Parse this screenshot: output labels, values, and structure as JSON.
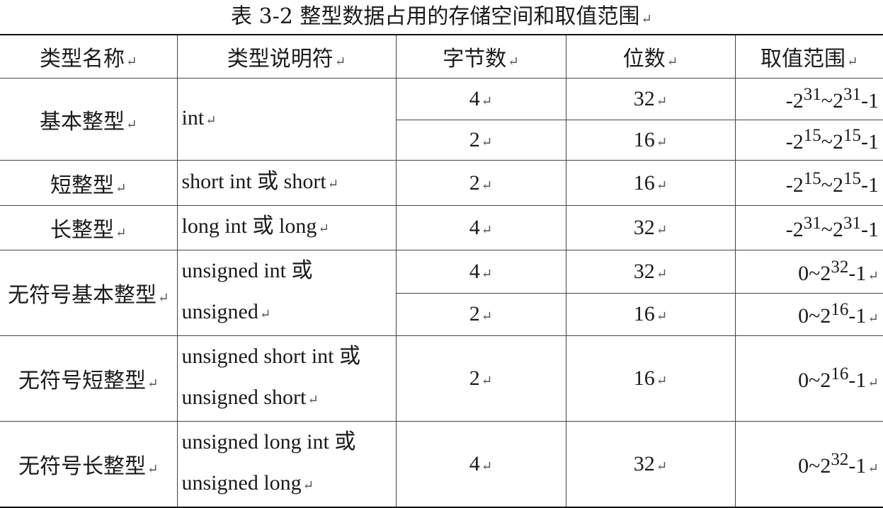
{
  "caption": "表 3-2  整型数据占用的存储空间和取值范围",
  "cell_mark": "↵",
  "columns": [
    "类型名称",
    "类型说明符",
    "字节数",
    "位数",
    "取值范围"
  ],
  "rows": [
    {
      "name": "基本整型",
      "spec": [
        "int"
      ],
      "variants": [
        {
          "bytes": "4",
          "bits": "32",
          "range": {
            "lead": "-2",
            "e1": "31",
            "mid": "~2",
            "e2": "31",
            "tail": "-1"
          }
        },
        {
          "bytes": "2",
          "bits": "16",
          "range": {
            "lead": "-2",
            "e1": "15",
            "mid": "~2",
            "e2": "15",
            "tail": "-1"
          }
        }
      ]
    },
    {
      "name": "短整型",
      "spec": [
        "short int 或 short"
      ],
      "variants": [
        {
          "bytes": "2",
          "bits": "16",
          "range": {
            "lead": "-2",
            "e1": "15",
            "mid": "~2",
            "e2": "15",
            "tail": "-1"
          }
        }
      ]
    },
    {
      "name": "长整型",
      "spec": [
        "long int 或 long"
      ],
      "variants": [
        {
          "bytes": "4",
          "bits": "32",
          "range": {
            "lead": "-2",
            "e1": "31",
            "mid": "~2",
            "e2": "31",
            "tail": "-1"
          }
        }
      ]
    },
    {
      "name": "无符号基本整型",
      "spec": [
        "unsigned int 或",
        "unsigned"
      ],
      "variants": [
        {
          "bytes": "4",
          "bits": "32",
          "range": {
            "lead": "0~2",
            "e1": "32",
            "tail": "-1"
          }
        },
        {
          "bytes": "2",
          "bits": "16",
          "range": {
            "lead": "0~2",
            "e1": "16",
            "tail": "-1"
          }
        }
      ]
    },
    {
      "name": "无符号短整型",
      "spec": [
        "unsigned short int 或",
        "unsigned short"
      ],
      "variants": [
        {
          "bytes": "2",
          "bits": "16",
          "range": {
            "lead": "0~2",
            "e1": "16",
            "tail": "-1"
          }
        }
      ]
    },
    {
      "name": "无符号长整型",
      "spec": [
        "unsigned long int 或",
        "unsigned long"
      ],
      "variants": [
        {
          "bytes": "4",
          "bits": "32",
          "range": {
            "lead": "0~2",
            "e1": "32",
            "tail": "-1"
          }
        }
      ]
    }
  ]
}
